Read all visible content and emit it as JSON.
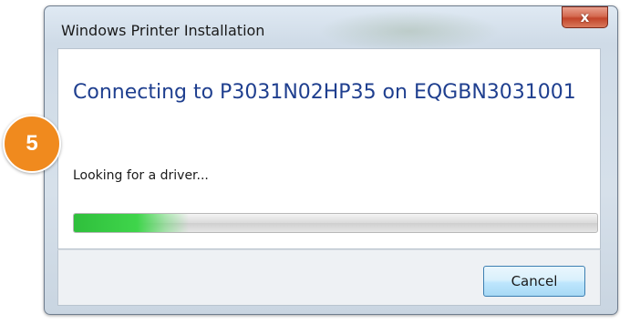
{
  "window": {
    "title": "Windows Printer Installation",
    "close_label": "x"
  },
  "main": {
    "heading": "Connecting to P3031N02HP35 on EQGBN3031001",
    "status_text": "Looking for a driver...",
    "progress_fraction": 0.22
  },
  "footer": {
    "cancel_label": "Cancel"
  },
  "step_badge": {
    "number": "5"
  },
  "colors": {
    "heading": "#1f3f8f",
    "progress_fill": "#3fd54b",
    "badge": "#f08a1e",
    "close_button": "#c2442a"
  },
  "icons": [
    "close-icon"
  ]
}
